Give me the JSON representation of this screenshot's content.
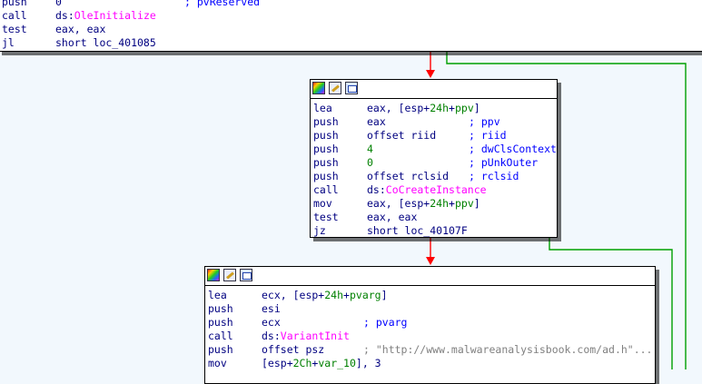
{
  "colors": {
    "background": "#f2f8fd",
    "edge_false": "#ff0000",
    "edge_true": "#00a000",
    "mnemonic": "#000080",
    "api_name": "#ff00ff",
    "number": "#008000",
    "comment": "#0000ff",
    "string": "#808080"
  },
  "icons": [
    "palette-icon",
    "rename-icon",
    "graph-overview-icon"
  ],
  "block_top": {
    "lines": [
      {
        "mnemonic": "push",
        "operand": [
          {
            "t": "0"
          }
        ],
        "comment": "; pvReserved"
      },
      {
        "mnemonic": "call",
        "operand": [
          {
            "t": "ds:"
          },
          {
            "t": "OleInitialize",
            "c": "api"
          }
        ]
      },
      {
        "mnemonic": "test",
        "operand": [
          {
            "t": "eax, eax"
          }
        ]
      },
      {
        "mnemonic": "jl",
        "operand": [
          {
            "t": "short loc_401085"
          }
        ]
      }
    ]
  },
  "block_mid": {
    "lines": [
      {
        "mnemonic": "lea",
        "operand": [
          {
            "t": "eax, [esp+"
          },
          {
            "t": "24h",
            "c": "num"
          },
          {
            "t": "+"
          },
          {
            "t": "ppv",
            "c": "num"
          },
          {
            "t": "]"
          }
        ]
      },
      {
        "mnemonic": "push",
        "operand": [
          {
            "t": "eax"
          }
        ],
        "comment": "; ppv"
      },
      {
        "mnemonic": "push",
        "operand": [
          {
            "t": "offset riid"
          }
        ],
        "comment": "; riid"
      },
      {
        "mnemonic": "push",
        "operand": [
          {
            "t": "4",
            "c": "num"
          }
        ],
        "comment": "; dwClsContext"
      },
      {
        "mnemonic": "push",
        "operand": [
          {
            "t": "0",
            "c": "num"
          }
        ],
        "comment": "; pUnkOuter"
      },
      {
        "mnemonic": "push",
        "operand": [
          {
            "t": "offset rclsid"
          }
        ],
        "comment": "; rclsid"
      },
      {
        "mnemonic": "call",
        "operand": [
          {
            "t": "ds:"
          },
          {
            "t": "CoCreateInstance",
            "c": "api"
          }
        ]
      },
      {
        "mnemonic": "mov",
        "operand": [
          {
            "t": "eax, [esp+"
          },
          {
            "t": "24h",
            "c": "num"
          },
          {
            "t": "+"
          },
          {
            "t": "ppv",
            "c": "num"
          },
          {
            "t": "]"
          }
        ]
      },
      {
        "mnemonic": "test",
        "operand": [
          {
            "t": "eax, eax"
          }
        ]
      },
      {
        "mnemonic": "jz",
        "operand": [
          {
            "t": "short loc_40107F"
          }
        ]
      }
    ]
  },
  "block_bottom": {
    "lines": [
      {
        "mnemonic": "lea",
        "operand": [
          {
            "t": "ecx, [esp+"
          },
          {
            "t": "24h",
            "c": "num"
          },
          {
            "t": "+"
          },
          {
            "t": "pvarg",
            "c": "num"
          },
          {
            "t": "]"
          }
        ]
      },
      {
        "mnemonic": "push",
        "operand": [
          {
            "t": "esi"
          }
        ]
      },
      {
        "mnemonic": "push",
        "operand": [
          {
            "t": "ecx"
          }
        ],
        "comment": "; pvarg"
      },
      {
        "mnemonic": "call",
        "operand": [
          {
            "t": "ds:"
          },
          {
            "t": "VariantInit",
            "c": "api"
          }
        ]
      },
      {
        "mnemonic": "push",
        "operand": [
          {
            "t": "offset psz"
          }
        ],
        "comment": "; \"http://www.malwareanalysisbook.com/ad.h\"...",
        "comment_style": "str"
      },
      {
        "mnemonic": "mov",
        "operand": [
          {
            "t": "[esp+"
          },
          {
            "t": "2Ch",
            "c": "num"
          },
          {
            "t": "+"
          },
          {
            "t": "var_10",
            "c": "num"
          },
          {
            "t": "], 3"
          }
        ]
      }
    ]
  }
}
